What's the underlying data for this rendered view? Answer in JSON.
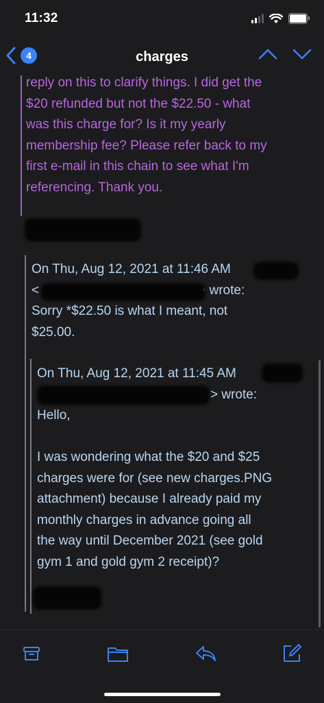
{
  "status_bar": {
    "time": "11:32"
  },
  "nav": {
    "back_count": "4",
    "title": "charges"
  },
  "message": {
    "intro_lines": [
      "reply on this to clarify things. I did get the",
      "$20 refunded but not the $22.50 - what",
      "was this charge for? Is it my yearly",
      "membership fee? Please refer back to my",
      "first e-mail in this chain to see what I'm",
      "referencing. Thank you."
    ],
    "quote1": {
      "header_line1": "On Thu, Aug 12, 2021 at 11:46 AM",
      "header_line2_prefix": "<",
      "header_line2_suffix": "> wrote:",
      "body_lines": [
        "Sorry *$22.50 is what I meant, not",
        "$25.00."
      ]
    },
    "quote2": {
      "header_line1": "On Thu, Aug 12, 2021 at 11:45 AM",
      "header_line2_suffix": "> wrote:",
      "greeting": "Hello,",
      "body_lines": [
        "I was wondering what the $20 and $25",
        "charges were for (see new charges.PNG",
        "attachment) because I already paid my",
        "monthly charges in advance going all",
        "the way until December 2021 (see gold",
        "gym 1 and gold gym 2 receipt)?"
      ]
    }
  },
  "toolbar": {
    "icons": [
      "archive-icon",
      "folder-icon",
      "reply-icon",
      "compose-icon"
    ]
  },
  "colors": {
    "accent": "#3a82f7",
    "purple_text": "#b766e0",
    "quote_text": "#b9d6f0",
    "background": "#1c1c1e"
  }
}
